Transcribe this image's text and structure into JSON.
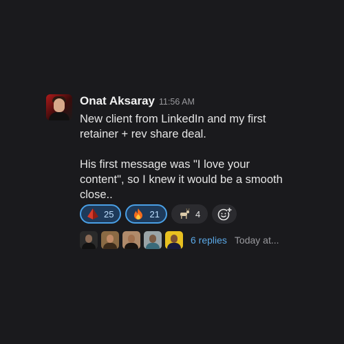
{
  "message": {
    "author": "Onat Aksaray",
    "timestamp": "11:56 AM",
    "paragraphs": [
      [
        "New client from LinkedIn and my first",
        "retainer + rev share deal."
      ],
      [
        "His first message was \"I love your",
        "content\", so I knew it would be a smooth",
        "close.."
      ]
    ]
  },
  "reactions": [
    {
      "emoji": "red-pyramid-icon",
      "count": "25",
      "active": true
    },
    {
      "emoji": "fire-icon",
      "count": "21",
      "active": true
    },
    {
      "emoji": "goat-icon",
      "count": "4",
      "active": false
    }
  ],
  "add_reaction": {
    "icon": "add-reaction-icon"
  },
  "thread": {
    "replies_label": "6 replies",
    "last_reply_label": "Today at..."
  },
  "colors": {
    "background": "#1a1a1d",
    "link_blue": "#5aa8e6",
    "reaction_active_border": "#4aa0e6",
    "reaction_active_bg": "#1e3a5a"
  }
}
